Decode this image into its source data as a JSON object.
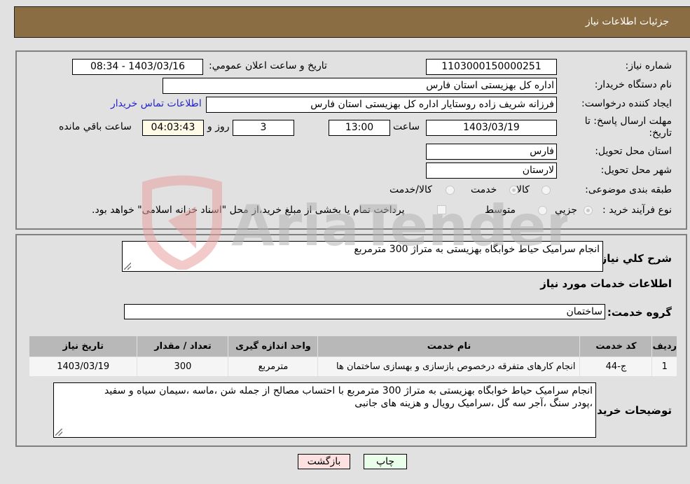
{
  "header": {
    "title": "جزئیات اطلاعات نیاز"
  },
  "form": {
    "need_number": {
      "label": "شماره نیاز:",
      "value": "1103000150000251"
    },
    "announce_datetime": {
      "label": "تاریخ و ساعت اعلان عمومي:",
      "value": "1403/03/16 - 08:34"
    },
    "buyer_org": {
      "label": "نام دستگاه خریدار:",
      "value": "اداره کل بهزیستی استان فارس"
    },
    "requester": {
      "label": "ایجاد کننده درخواست:",
      "value": "فرزانه شریف زاده روستایار اداره کل بهزیستی استان فارس"
    },
    "buyer_contact_link": "اطلاعات تماس خریدار",
    "deadline": {
      "label_line1": "مهلت ارسال پاسخ: تا",
      "label_line2": "تاریخ:",
      "date": "1403/03/19",
      "time_label": "ساعت",
      "time": "13:00",
      "days": "3",
      "days_label": "روز و",
      "remaining": "04:03:43",
      "remaining_label": "ساعت باقي مانده"
    },
    "delivery_province": {
      "label": "استان محل تحویل:",
      "value": "فارس"
    },
    "delivery_city": {
      "label": "شهر محل تحویل:",
      "value": "لارستان"
    },
    "category": {
      "label": "طبقه بندی موضوعی:",
      "options": [
        "کالا",
        "خدمت",
        "کالا/خدمت"
      ],
      "selected": "خدمت"
    },
    "purchase_type": {
      "label": "نوع فرآیند خرید :",
      "options": [
        "جزیي",
        "متوسط"
      ],
      "selected": "جزیي",
      "treasury_note": "پرداخت تمام یا بخشی از مبلغ خرید،از محل \"اسناد خزانه اسلامی\" خواهد بود."
    }
  },
  "details": {
    "general_desc": {
      "label": "شرح کلي نیاز:",
      "value": "انجام سرامیک حیاط خوابگاه بهزیستی به متراژ 300 مترمربع"
    },
    "services_heading": "اطلاعات خدمات مورد نیاز",
    "service_group": {
      "label": "گروه خدمت:",
      "value": "ساختمان"
    },
    "table": {
      "headers": [
        "ردیف",
        "کد خدمت",
        "نام خدمت",
        "واحد اندازه گیری",
        "تعداد / مقدار",
        "تاریخ نیاز"
      ],
      "rows": [
        [
          "1",
          "ج-44",
          "انجام کارهای متفرقه درخصوص بازسازی و بهسازی ساختمان ها",
          "مترمربع",
          "300",
          "1403/03/19"
        ]
      ]
    },
    "buyer_notes": {
      "label": "توضیحات خریدار:",
      "line1": "انجام سرامیک حیاط خوابگاه بهزیستی به متراژ 300 مترمربع با احتساب مصالح از جمله شن ،ماسه ،سیمان سیاه و سفید",
      "line2": "،پودر سنگ ،آجر سه گل ،سرامیک رویال و هزینه های جانبی"
    }
  },
  "buttons": {
    "print": "چاپ",
    "back": "بازگشت"
  },
  "watermark": {
    "text": "AriaTender.neT"
  },
  "colors": {
    "header_bg": "#8b6d43",
    "link": "#2525c8",
    "back_btn": "#fde0e0",
    "print_btn": "#eaffea"
  }
}
